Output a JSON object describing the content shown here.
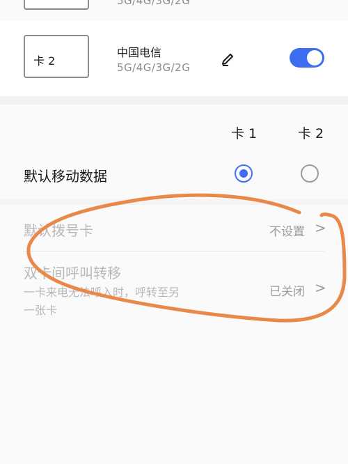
{
  "sim_cards": [
    {
      "card_label": "",
      "carrier": "",
      "network_modes": "5G/4G/3G/2G"
    },
    {
      "card_label": "卡 2",
      "carrier": "中国电信",
      "network_modes": "5G/4G/3G/2G",
      "enabled": true
    }
  ],
  "default_data": {
    "col1": "卡 1",
    "col2": "卡 2",
    "title": "默认移动数据",
    "selected": "卡 1"
  },
  "default_call": {
    "title": "默认拨号卡",
    "value": "不设置"
  },
  "call_forwarding": {
    "title": "双卡间呼叫转移",
    "subtitle_line1": "一卡来电无法呼入时，呼转至另",
    "subtitle_line2": "一张卡",
    "value": "已关闭"
  },
  "chevron": ">",
  "colors": {
    "accent": "#3d6ef2",
    "annotation": "#e8894a"
  }
}
